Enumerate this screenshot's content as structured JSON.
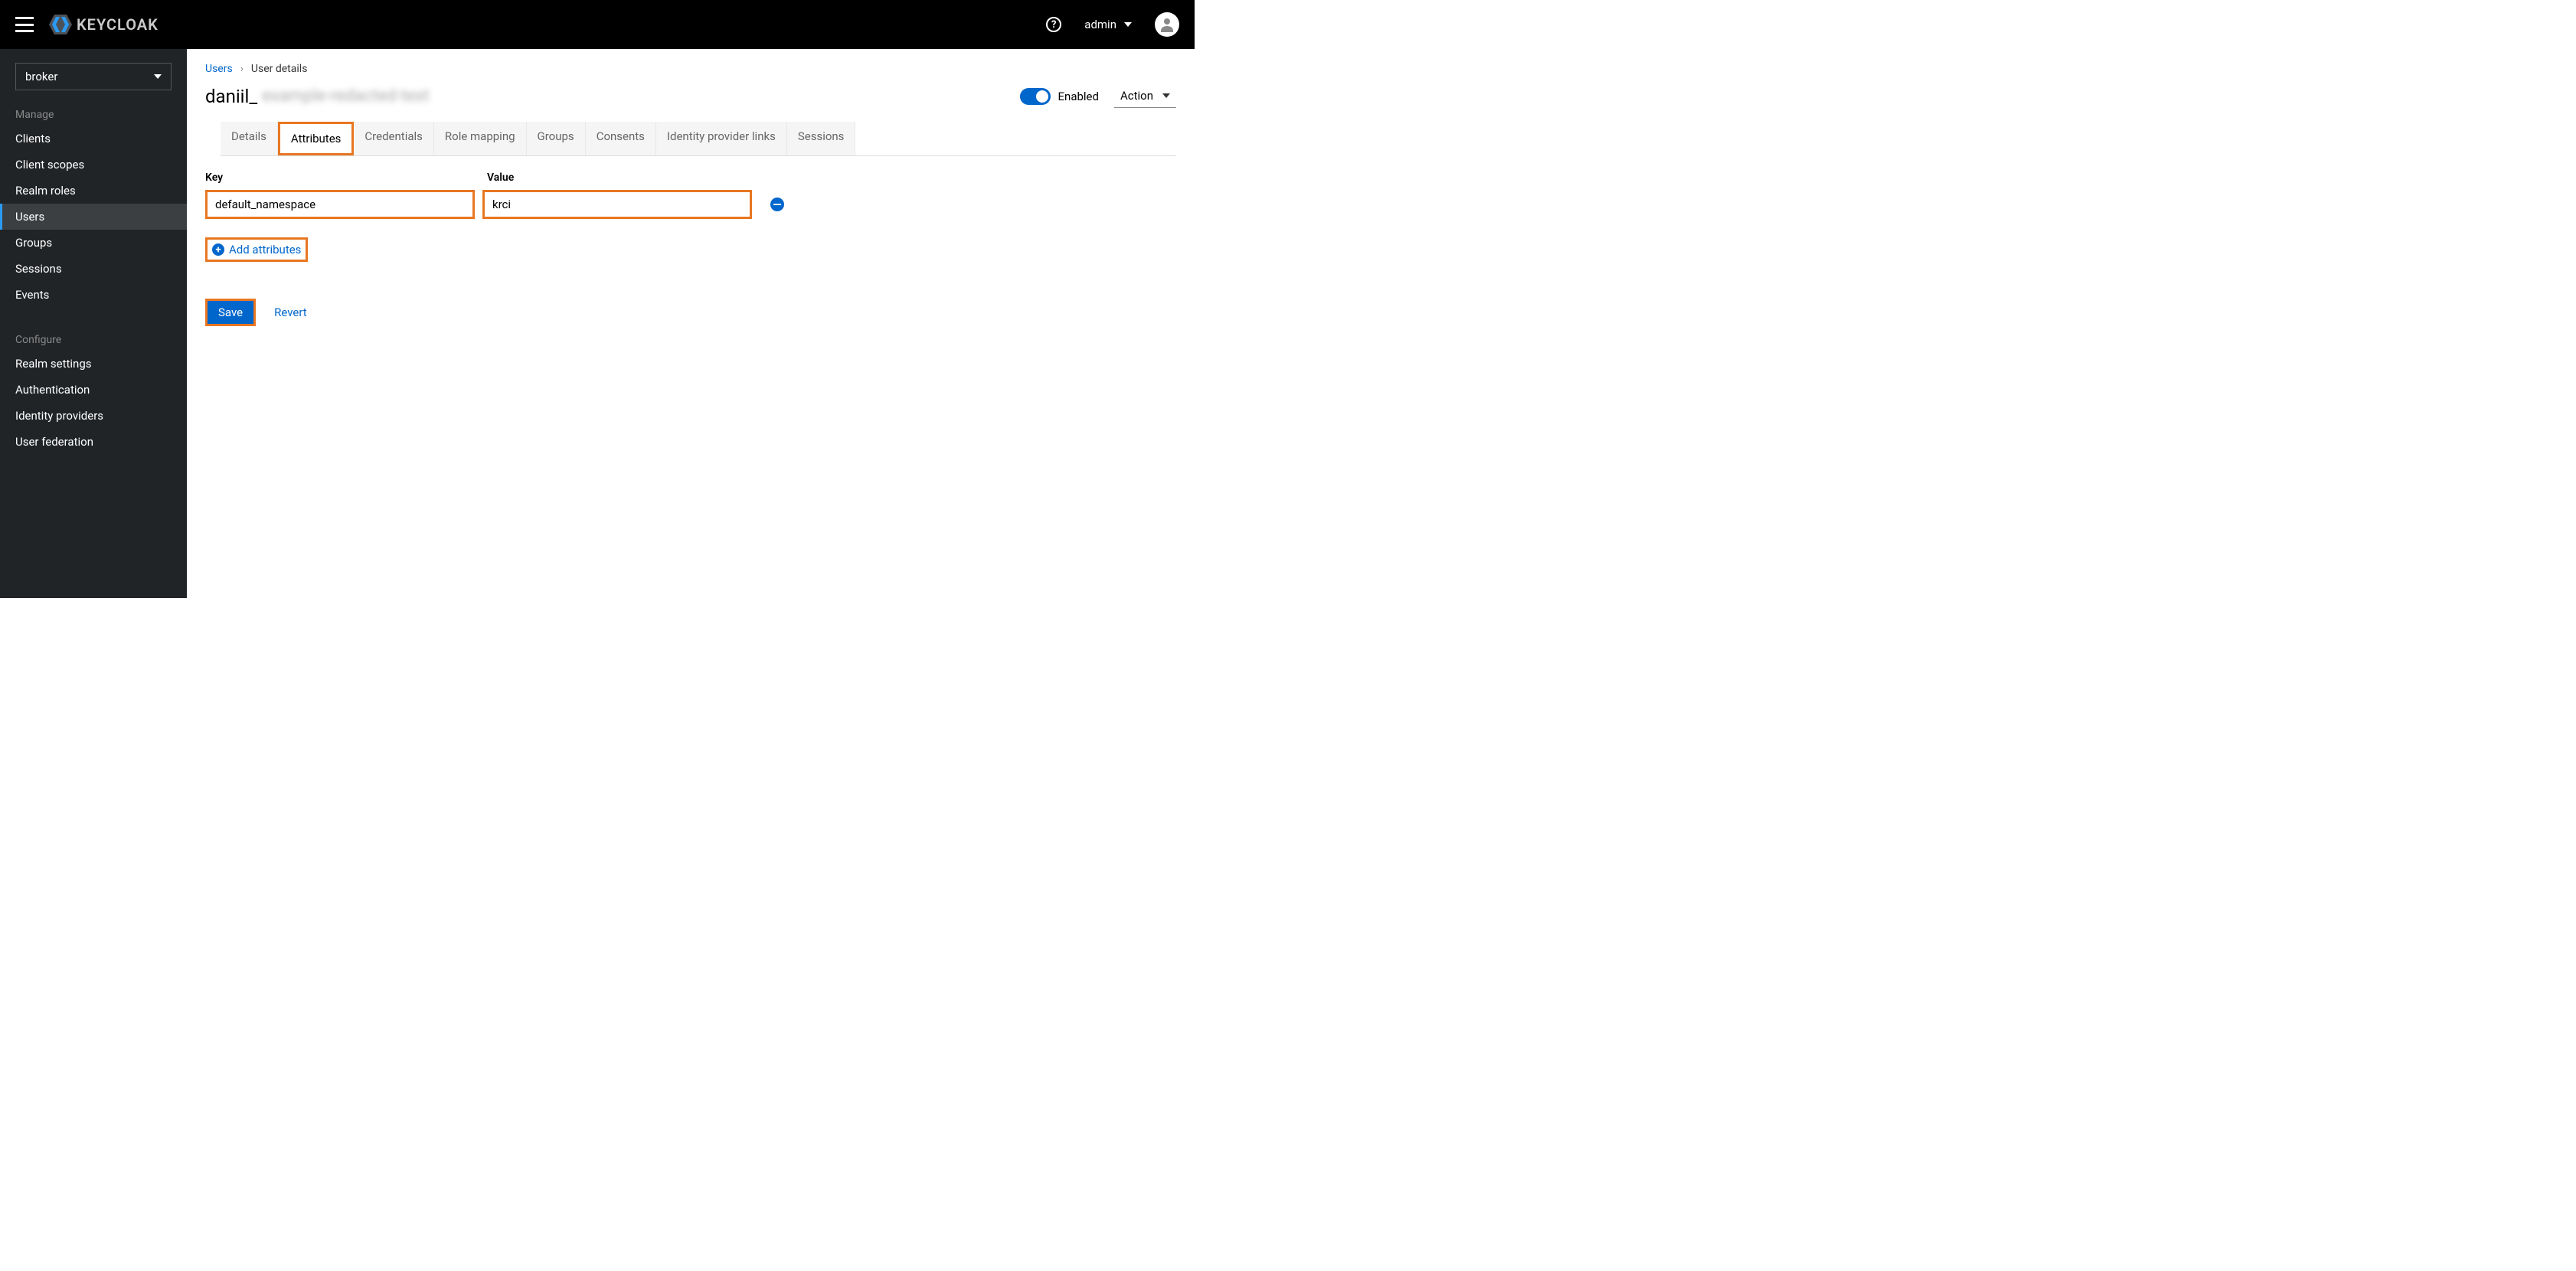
{
  "header": {
    "logo_text": "KEYCLOAK",
    "username": "admin"
  },
  "sidebar": {
    "realm": "broker",
    "section_manage": "Manage",
    "section_configure": "Configure",
    "items_manage": [
      {
        "label": "Clients"
      },
      {
        "label": "Client scopes"
      },
      {
        "label": "Realm roles"
      },
      {
        "label": "Users"
      },
      {
        "label": "Groups"
      },
      {
        "label": "Sessions"
      },
      {
        "label": "Events"
      }
    ],
    "items_configure": [
      {
        "label": "Realm settings"
      },
      {
        "label": "Authentication"
      },
      {
        "label": "Identity providers"
      },
      {
        "label": "User federation"
      }
    ]
  },
  "breadcrumb": {
    "users": "Users",
    "current": "User details"
  },
  "page": {
    "title_prefix": "daniil_",
    "title_blur": "example-redacted-text",
    "enabled_label": "Enabled",
    "action_label": "Action"
  },
  "tabs": [
    {
      "label": "Details"
    },
    {
      "label": "Attributes"
    },
    {
      "label": "Credentials"
    },
    {
      "label": "Role mapping"
    },
    {
      "label": "Groups"
    },
    {
      "label": "Consents"
    },
    {
      "label": "Identity provider links"
    },
    {
      "label": "Sessions"
    }
  ],
  "attributes": {
    "key_header": "Key",
    "value_header": "Value",
    "rows": [
      {
        "key": "default_namespace",
        "value": "krci"
      }
    ],
    "add_label": "Add attributes",
    "save_label": "Save",
    "revert_label": "Revert"
  }
}
